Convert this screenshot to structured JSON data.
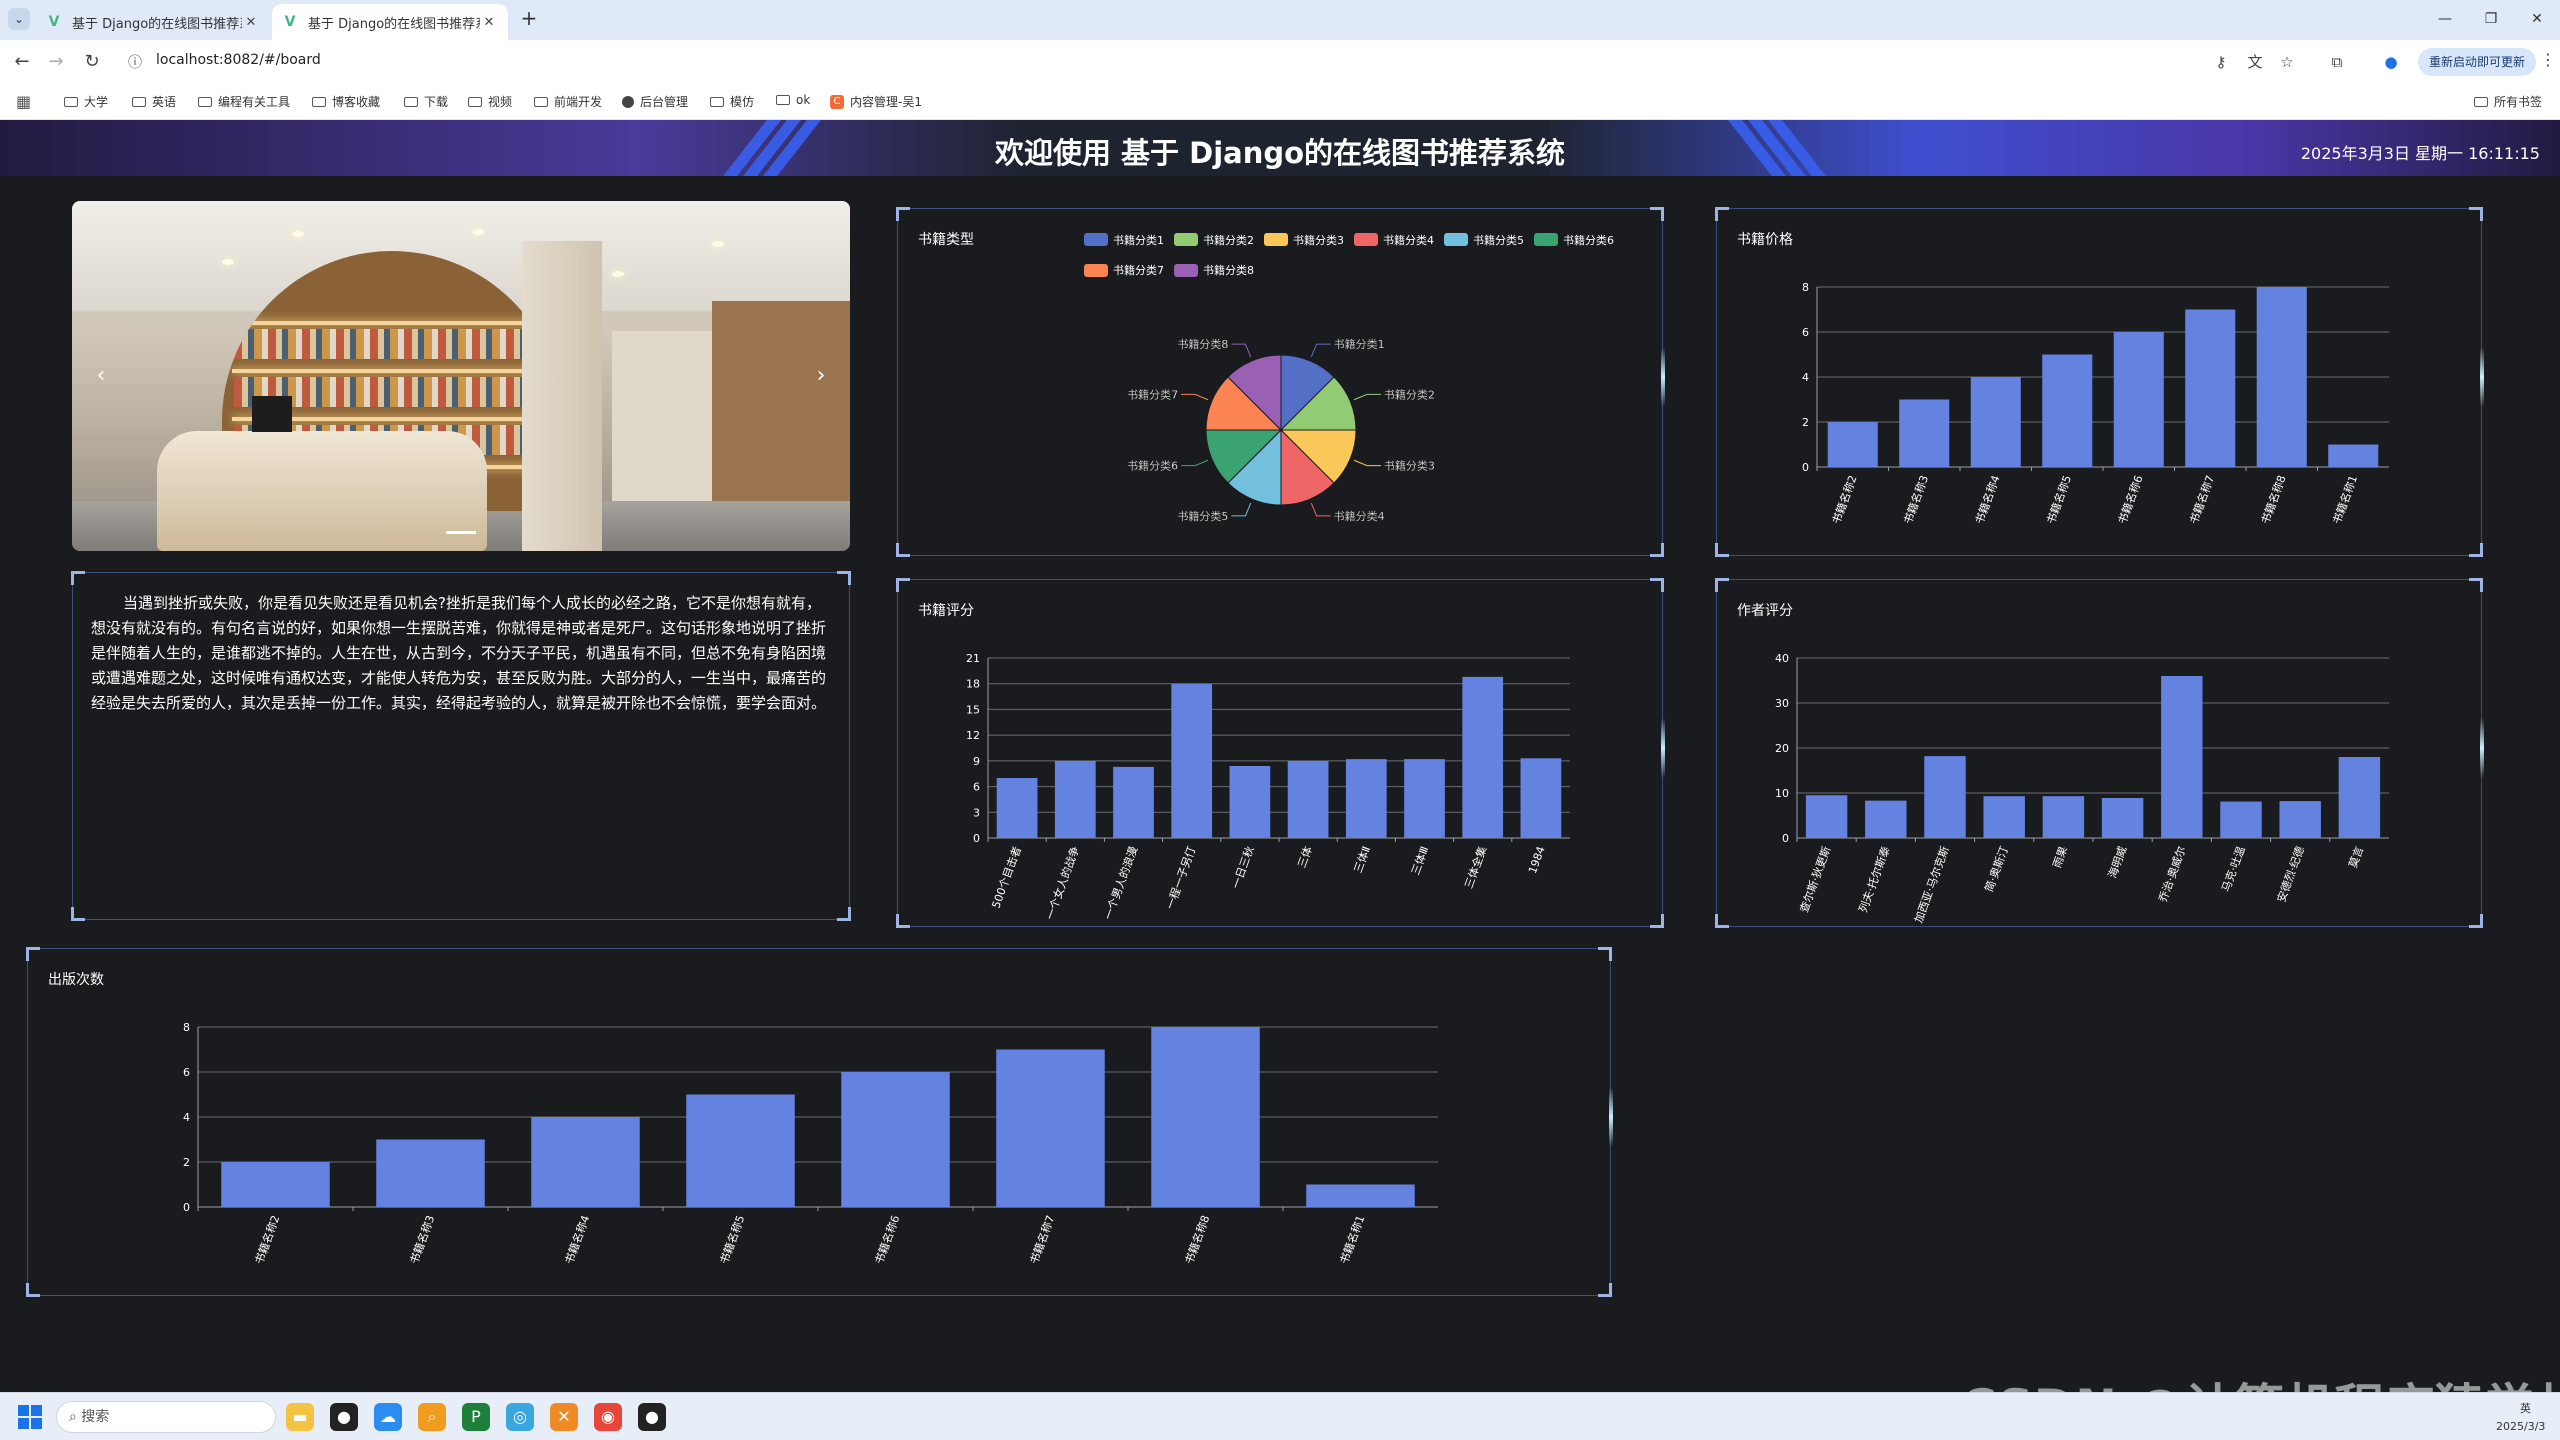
{
  "browser": {
    "tabs": [
      {
        "title": "基于 Django的在线图书推荐系",
        "active": false
      },
      {
        "title": "基于 Django的在线图书推荐系",
        "active": true
      }
    ],
    "url": "localhost:8082/#/board",
    "update_button": "重新启动即可更新",
    "bookmarks": [
      "大学",
      "英语",
      "编程有关工具",
      "博客收藏",
      "下载",
      "视频",
      "前端开发",
      "后台管理",
      "模仿",
      "ok",
      "内容管理-吴1"
    ],
    "all_bookmarks": "所有书签"
  },
  "header": {
    "title": "欢迎使用 基于 Django的在线图书推荐系统",
    "datetime": "2025年3月3日 星期一 16:11:15"
  },
  "intro": {
    "text": "当遇到挫折或失败，你是看见失败还是看见机会?挫折是我们每个人成长的必经之路，它不是你想有就有，想没有就没有的。有句名言说的好，如果你想一生摆脱苦难，你就得是神或者是死尸。这句话形象地说明了挫折是伴随着人生的，是谁都逃不掉的。人生在世，从古到今，不分天子平民，机遇虽有不同，但总不免有身陷困境或遭遇难题之处，这时候唯有通权达变，才能使人转危为安，甚至反败为胜。大部分的人，一生当中，最痛苦的经验是失去所爱的人，其次是丢掉一份工作。其实，经得起考验的人，就算是被开除也不会惊慌，要学会面对。"
  },
  "charts": {
    "type_title": "书籍类型",
    "price_title": "书籍价格",
    "rating_title": "书籍评分",
    "author_title": "作者评分",
    "pub_title": "出版次数"
  },
  "colors": {
    "bar": "#6482df",
    "pie": [
      "#5470c6",
      "#91cc75",
      "#fac858",
      "#ee6666",
      "#73c0de",
      "#3ba272",
      "#fc8452",
      "#9a60b4"
    ]
  },
  "chart_data": [
    {
      "type": "pie",
      "title": "书籍类型",
      "categories": [
        "书籍分类1",
        "书籍分类2",
        "书籍分类3",
        "书籍分类4",
        "书籍分类5",
        "书籍分类6",
        "书籍分类7",
        "书籍分类8"
      ],
      "values": [
        1,
        1,
        1,
        1,
        1,
        1,
        1,
        1
      ],
      "legend": "top-right"
    },
    {
      "type": "bar",
      "title": "书籍价格",
      "categories": [
        "书籍名称2",
        "书籍名称3",
        "书籍名称4",
        "书籍名称5",
        "书籍名称6",
        "书籍名称7",
        "书籍名称8",
        "书籍名称1"
      ],
      "values": [
        2,
        3,
        4,
        5,
        6,
        7,
        8,
        1
      ],
      "ylim": [
        0,
        8
      ],
      "yticks": [
        0,
        2,
        4,
        6,
        8
      ]
    },
    {
      "type": "bar",
      "title": "书籍评分",
      "categories": [
        "500个目击者",
        "一个女人的战争",
        "一个男人的浪漫",
        "一程一子另仃",
        "一日三秋",
        "三体",
        "三体Ⅱ",
        "三体Ⅲ",
        "三体全集",
        "1984"
      ],
      "values": [
        7,
        9,
        8.3,
        18,
        8.4,
        9,
        9.2,
        9.2,
        18.8,
        9.3
      ],
      "ylim": [
        0,
        21
      ],
      "yticks": [
        0,
        3,
        6,
        9,
        12,
        15,
        18,
        21
      ]
    },
    {
      "type": "bar",
      "title": "作者评分",
      "categories": [
        "查尔斯·狄更斯",
        "列夫·托尔斯泰",
        "加西亚·马尔克斯",
        "简·奥斯汀",
        "雨果",
        "海明威",
        "乔治·奥威尔",
        "马克·吐温",
        "安德烈·纪德",
        "莫言"
      ],
      "values": [
        9.5,
        8.3,
        18.2,
        9.3,
        9.3,
        8.9,
        36,
        8.1,
        8.2,
        18
      ],
      "ylim": [
        0,
        40
      ],
      "yticks": [
        0,
        10,
        20,
        30,
        40
      ]
    },
    {
      "type": "bar",
      "title": "出版次数",
      "categories": [
        "书籍名称2",
        "书籍名称3",
        "书籍名称4",
        "书籍名称5",
        "书籍名称6",
        "书籍名称7",
        "书籍名称8",
        "书籍名称1"
      ],
      "values": [
        2,
        3,
        4,
        5,
        6,
        7,
        8,
        1
      ],
      "ylim": [
        0,
        8
      ],
      "yticks": [
        0,
        2,
        4,
        6,
        8
      ]
    }
  ],
  "taskbar": {
    "search_placeholder": "搜索",
    "watermark": "CSDN @计算机程序猿学长",
    "tray_lang": "英",
    "tray_date": "2025/3/3"
  }
}
